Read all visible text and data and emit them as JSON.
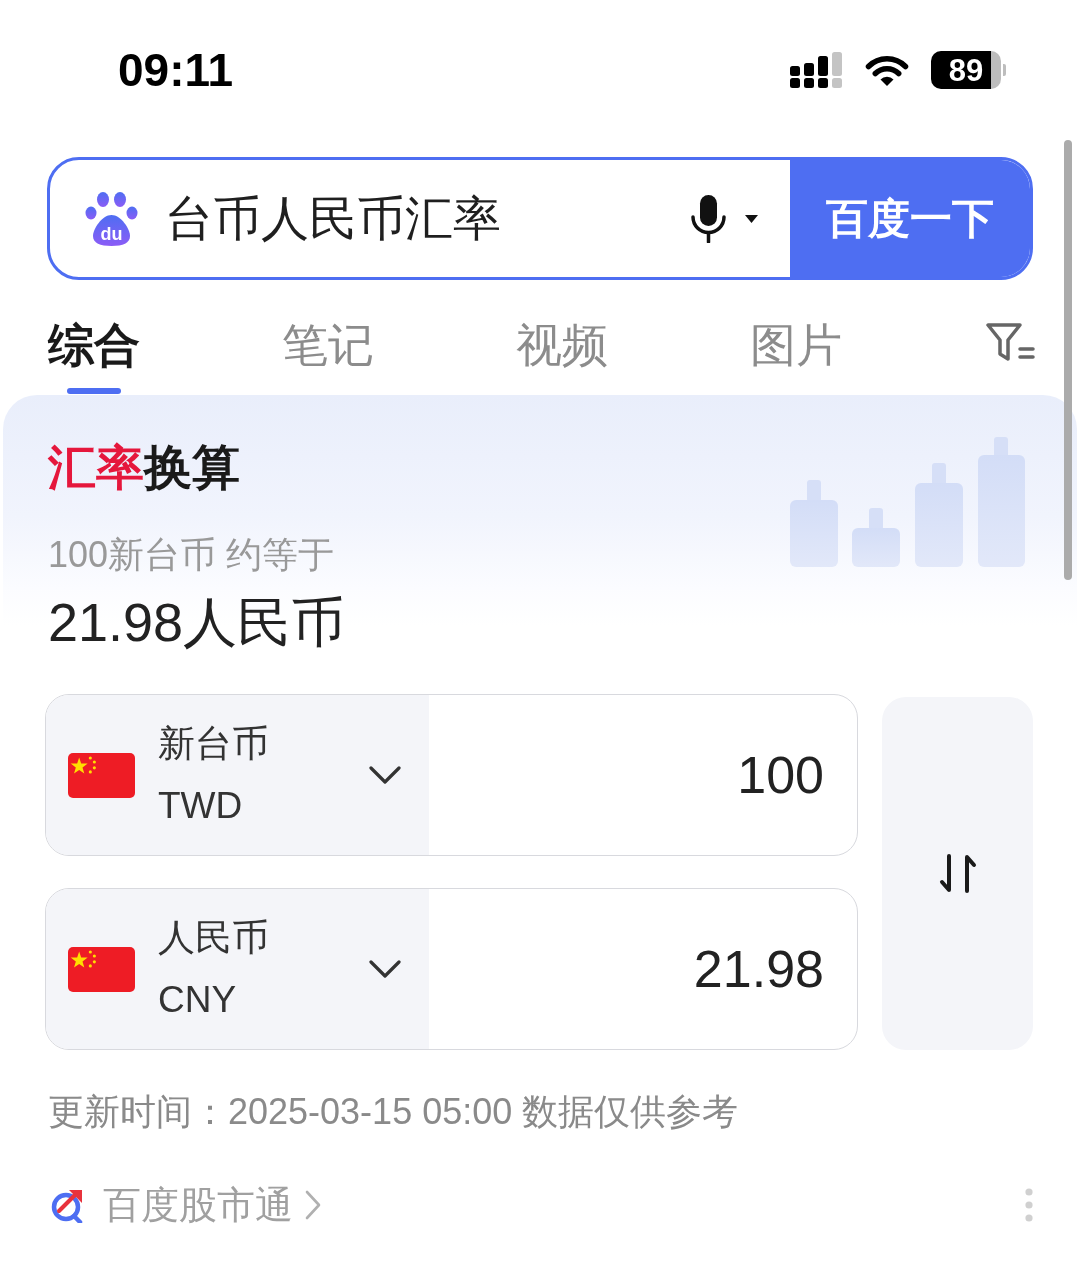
{
  "status_bar": {
    "time": "09:11",
    "battery": "89"
  },
  "search": {
    "logo_text": "du",
    "query": "台币人民币汇率",
    "button": "百度一下"
  },
  "tabs": [
    {
      "label": "综合",
      "selected": true
    },
    {
      "label": "笔记",
      "selected": false
    },
    {
      "label": "视频",
      "selected": false
    },
    {
      "label": "图片",
      "selected": false
    }
  ],
  "rate_card": {
    "title": [
      {
        "text": "汇率",
        "kind": "accent"
      },
      {
        "text": "换算",
        "kind": "plain"
      }
    ],
    "summary": "100新台币 约等于",
    "result": "21.98人民币"
  },
  "converter": {
    "rows": [
      {
        "name": "新台币",
        "code": "TWD",
        "amount": "100"
      },
      {
        "name": "人民币",
        "code": "CNY",
        "amount": "21.98"
      }
    ]
  },
  "update_note": "更新时间：2025-03-15 05:00 数据仅供参考",
  "source_link": "百度股市通"
}
